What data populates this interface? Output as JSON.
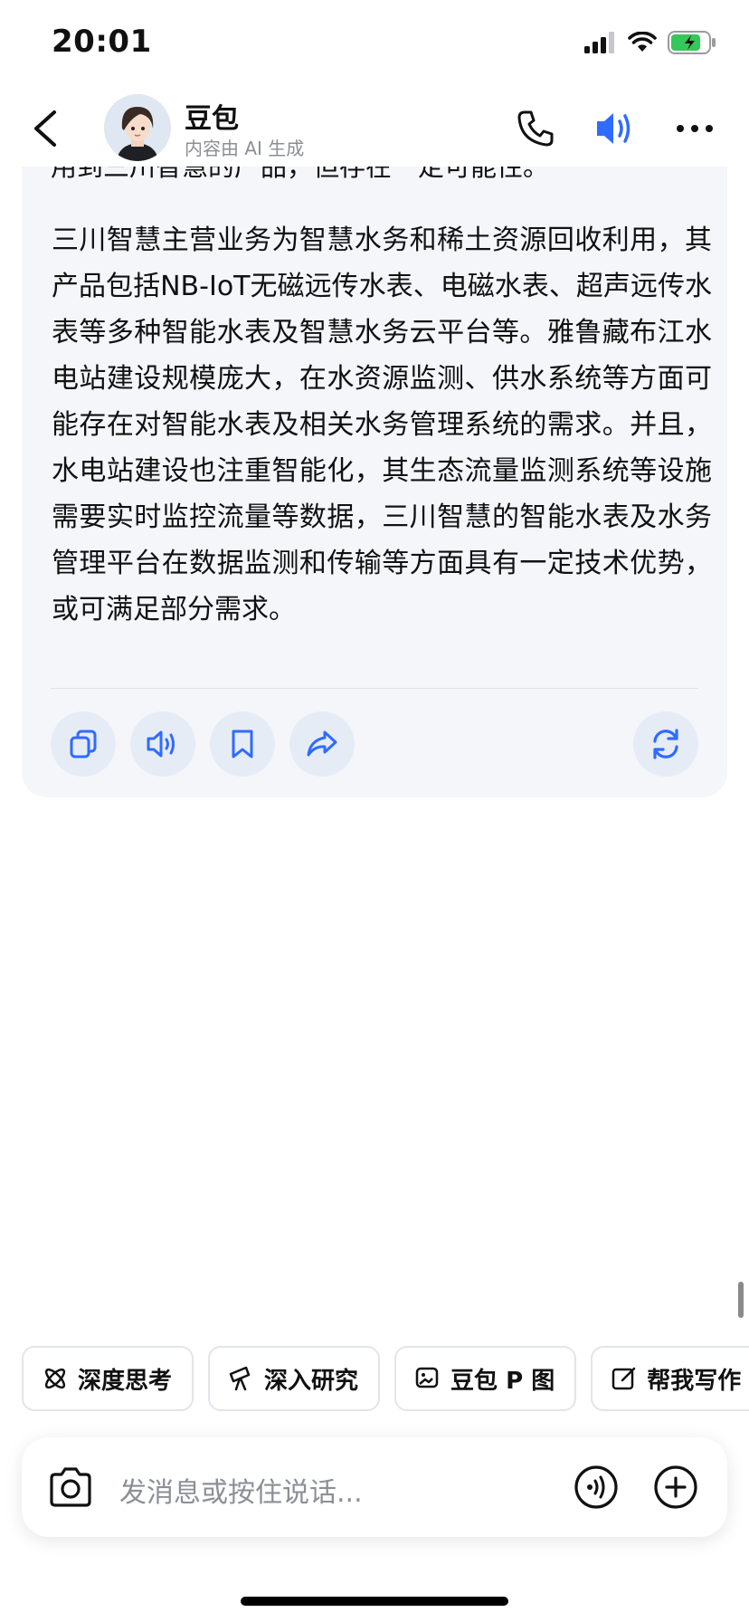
{
  "status_bar": {
    "time": "20:01",
    "battery_color": "#34c759"
  },
  "header": {
    "name": "豆包",
    "subtitle": "内容由 AI 生成",
    "accent": "#2f6bff"
  },
  "message": {
    "cut_off_text": "用到三川智慧的产品，但存在一定可能性。",
    "paragraph": "三川智慧主营业务为智慧水务和稀土资源回收利用，其产品包括NB-IoT无磁远传水表、电磁水表、超声远传水表等多种智能水表及智慧水务云平台等。雅鲁藏布江水电站建设规模庞大，在水资源监测、供水系统等方面可能存在对智能水表及相关水务管理系统的需求。并且，水电站建设也注重智能化，其生态流量监测系统等设施需要实时监控流量等数据，三川智慧的智能水表及水务管理平台在数据监测和传输等方面具有一定技术优势，或可满足部分需求。"
  },
  "actions": [
    {
      "icon": "copy-icon"
    },
    {
      "icon": "speaker-icon"
    },
    {
      "icon": "bookmark-icon"
    },
    {
      "icon": "share-icon"
    },
    {
      "icon": "regenerate-icon"
    }
  ],
  "chips": [
    {
      "label": "深度思考",
      "icon": "atom-icon"
    },
    {
      "label": "深入研究",
      "icon": "telescope-icon"
    },
    {
      "label": "豆包 P 图",
      "icon": "image-edit-icon"
    },
    {
      "label": "帮我写作",
      "icon": "edit-icon"
    }
  ],
  "input": {
    "placeholder": "发消息或按住说话..."
  }
}
